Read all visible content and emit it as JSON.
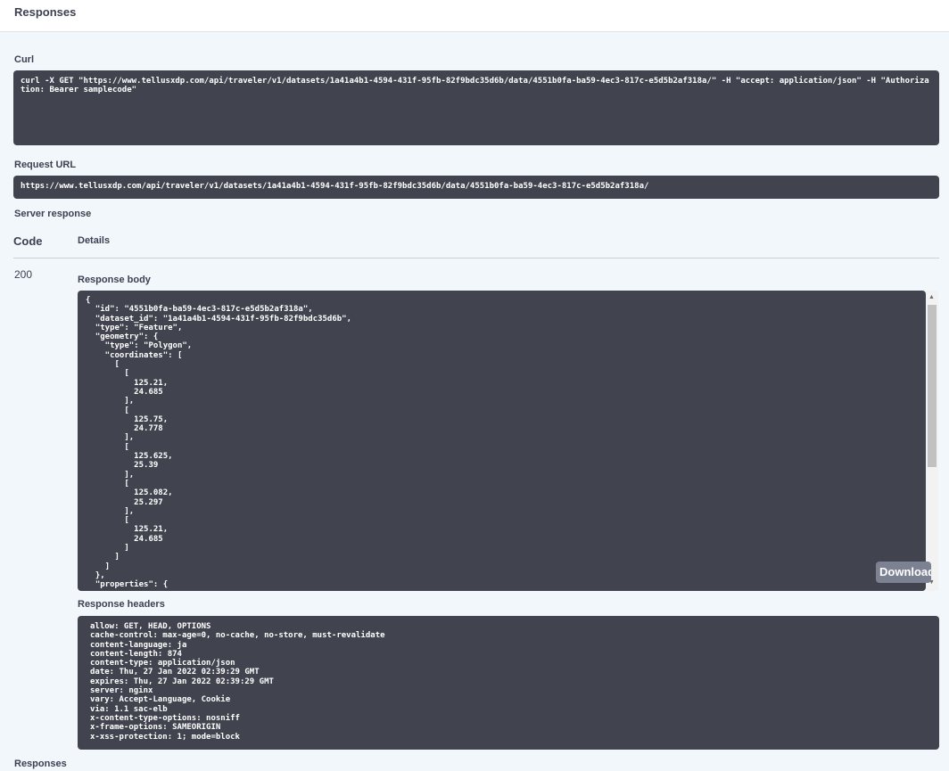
{
  "header": {
    "title": "Responses"
  },
  "curl": {
    "label": "Curl",
    "command": "curl -X GET \"https://www.tellusxdp.com/api/traveler/v1/datasets/1a41a4b1-4594-431f-95fb-82f9bdc35d6b/data/4551b0fa-ba59-4ec3-817c-e5d5b2af318a/\" -H \"accept: application/json\" -H \"Authorization: Bearer samplecode\""
  },
  "request_url": {
    "label": "Request URL",
    "value": "https://www.tellusxdp.com/api/traveler/v1/datasets/1a41a4b1-4594-431f-95fb-82f9bdc35d6b/data/4551b0fa-ba59-4ec3-817c-e5d5b2af318a/"
  },
  "server_response": {
    "label": "Server response",
    "columns": {
      "code": "Code",
      "details": "Details"
    },
    "code": "200",
    "response_body_label": "Response body",
    "response_body": "{\n  \"id\": \"4551b0fa-ba59-4ec3-817c-e5d5b2af318a\",\n  \"dataset_id\": \"1a41a4b1-4594-431f-95fb-82f9bdc35d6b\",\n  \"type\": \"Feature\",\n  \"geometry\": {\n    \"type\": \"Polygon\",\n    \"coordinates\": [\n      [\n        [\n          125.21,\n          24.685\n        ],\n        [\n          125.75,\n          24.778\n        ],\n        [\n          125.625,\n          25.39\n        ],\n        [\n          125.082,\n          25.297\n        ],\n        [\n          125.21,\n          24.685\n        ]\n      ]\n    ]\n  },\n  \"properties\": {",
    "download_label": "Download",
    "response_headers_label": "Response headers",
    "response_headers": "allow: GET, HEAD, OPTIONS\ncache-control: max-age=0, no-cache, no-store, must-revalidate\ncontent-language: ja\ncontent-length: 874\ncontent-type: application/json\ndate: Thu, 27 Jan 2022 02:39:29 GMT\nexpires: Thu, 27 Jan 2022 02:39:29 GMT\nserver: nginx\nvary: Accept-Language, Cookie\nvia: 1.1 sac-elb\nx-content-type-options: nosniff\nx-frame-options: SAMEORIGIN\nx-xss-protection: 1; mode=block"
  },
  "footer": {
    "label": "Responses"
  }
}
